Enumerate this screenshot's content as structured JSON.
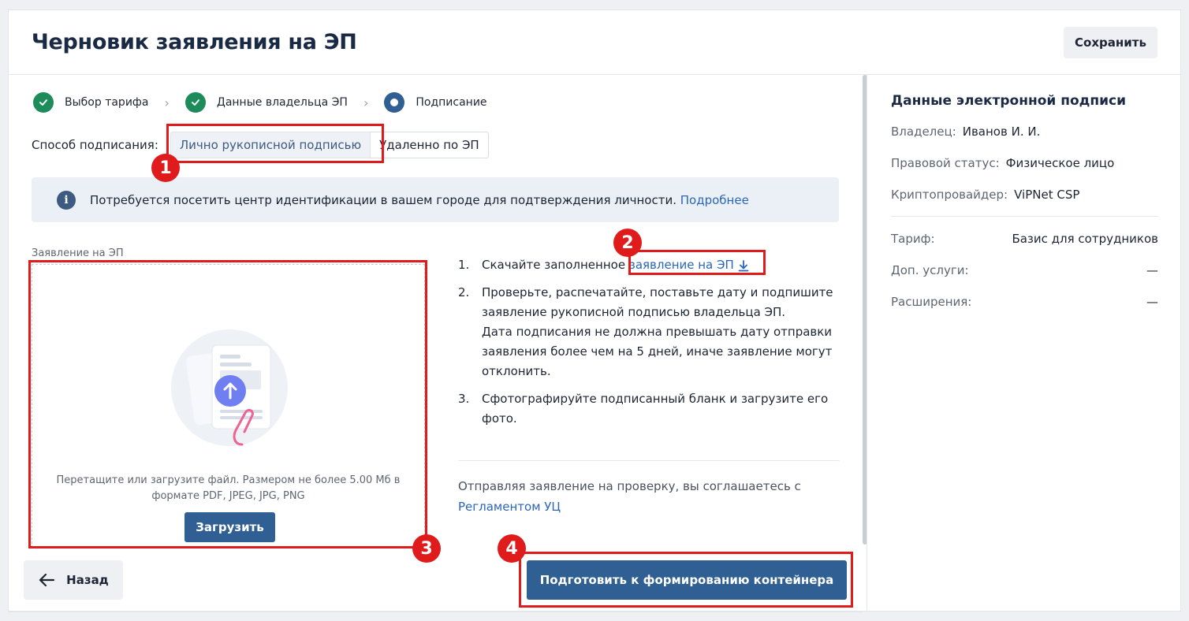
{
  "header": {
    "title": "Черновик заявления на ЭП",
    "save_label": "Сохранить"
  },
  "steps": [
    {
      "label": "Выбор тарифа",
      "state": "done"
    },
    {
      "label": "Данные владельца ЭП",
      "state": "done"
    },
    {
      "label": "Подписание",
      "state": "current"
    }
  ],
  "signing": {
    "label": "Способ подписания:",
    "options": [
      "Лично рукописной подписью",
      "Удаленно по ЭП"
    ],
    "selected": "Лично рукописной подписью"
  },
  "info": {
    "text": "Потребуется посетить центр идентификации в вашем городе для подтверждения личности.",
    "link": "Подробнее"
  },
  "upload": {
    "label": "Заявление на ЭП",
    "hint_line1": "Перетащите или загрузите файл. Размером не более 5.00 Мб в",
    "hint_line2": "формате PDF, JPEG, JPG, PNG",
    "button": "Загрузить"
  },
  "instructions": {
    "step1_num": "1.",
    "step1_text": "Скачайте заполненное",
    "step1_link": "заявление на ЭП",
    "step2_num": "2.",
    "step2_text": "Проверьте, распечатайте, поставьте дату и подпишите заявление рукописной подписью владельца ЭП.",
    "step2_note": "Дата подписания не должна превышать дату отправки заявления более чем на 5 дней, иначе заявление могут отклонить.",
    "step3_num": "3.",
    "step3_text": "Сфотографируйте подписанный бланк и загрузите его фото."
  },
  "consent": {
    "text": "Отправляя заявление на проверку, вы соглашаетесь с",
    "link": "Регламентом УЦ"
  },
  "footer": {
    "back_label": "Назад",
    "prepare_label": "Подготовить к формированию контейнера"
  },
  "sidebar": {
    "title": "Данные электронной подписи",
    "owner_label": "Владелец:",
    "owner_value": "Иванов И. И.",
    "status_label": "Правовой статус:",
    "status_value": "Физическое лицо",
    "crypto_label": "Криптопровайдер:",
    "crypto_value": "ViPNet CSP",
    "tariff_label": "Тариф:",
    "tariff_value": "Базис для сотрудников",
    "extras_label": "Доп. услуги:",
    "extras_value": "—",
    "ext_label": "Расширения:",
    "ext_value": "—"
  },
  "annotations": [
    "1",
    "2",
    "3",
    "4"
  ],
  "colors": {
    "primary": "#2f5f93",
    "success": "#1e8c5a",
    "link": "#2a66b8",
    "annotation": "#e01b1b"
  }
}
